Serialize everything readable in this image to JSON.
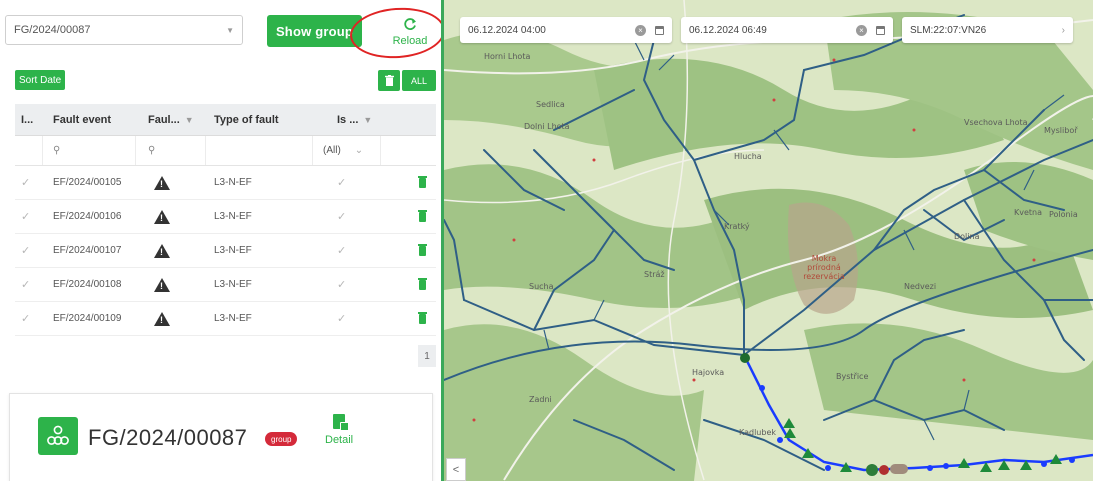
{
  "filter": {
    "group_value": "FG/2024/00087",
    "show_group_label": "Show group",
    "reload_label": "Reload"
  },
  "toolbar": {
    "sort_label": "Sort Date",
    "delete_all_label": "ALL"
  },
  "table": {
    "columns": [
      "I...",
      "Fault event",
      "Faul...",
      "Type of fault",
      "Is ..."
    ],
    "filter_all_label": "(All)",
    "rows": [
      {
        "event": "EF/2024/00105",
        "type": "L3-N-EF"
      },
      {
        "event": "EF/2024/00106",
        "type": "L3-N-EF"
      },
      {
        "event": "EF/2024/00107",
        "type": "L3-N-EF"
      },
      {
        "event": "EF/2024/00108",
        "type": "L3-N-EF"
      },
      {
        "event": "EF/2024/00109",
        "type": "L3-N-EF"
      }
    ],
    "page": "1"
  },
  "group_card": {
    "title": "FG/2024/00087",
    "badge": "group",
    "detail_label": "Detail"
  },
  "map": {
    "date_from": "06.12.2024 04:00",
    "date_to": "06.12.2024 06:49",
    "location": "SLM:22:07:VN26",
    "collapse_label": "<",
    "place_labels": [
      "Sedlica",
      "Dolni Lhota",
      "Hlucha",
      "Horni Lhota",
      "Vsechova Lhota",
      "Mysliboř",
      "Kvetna",
      "Polonia",
      "Dolina",
      "Nedvezi",
      "Kratký",
      "Stráž",
      "Sucha",
      "Hajovka",
      "Zadni",
      "Bystřice",
      "Kadlubek"
    ],
    "forest_label": "Mokra\nprírodná rezervácia",
    "colors": {
      "accent": "#2db34a",
      "power_line": "#2f5f86",
      "highlight_line": "#1a3cff",
      "badge": "#d42a3a",
      "annotation_ring": "#e02424"
    }
  }
}
